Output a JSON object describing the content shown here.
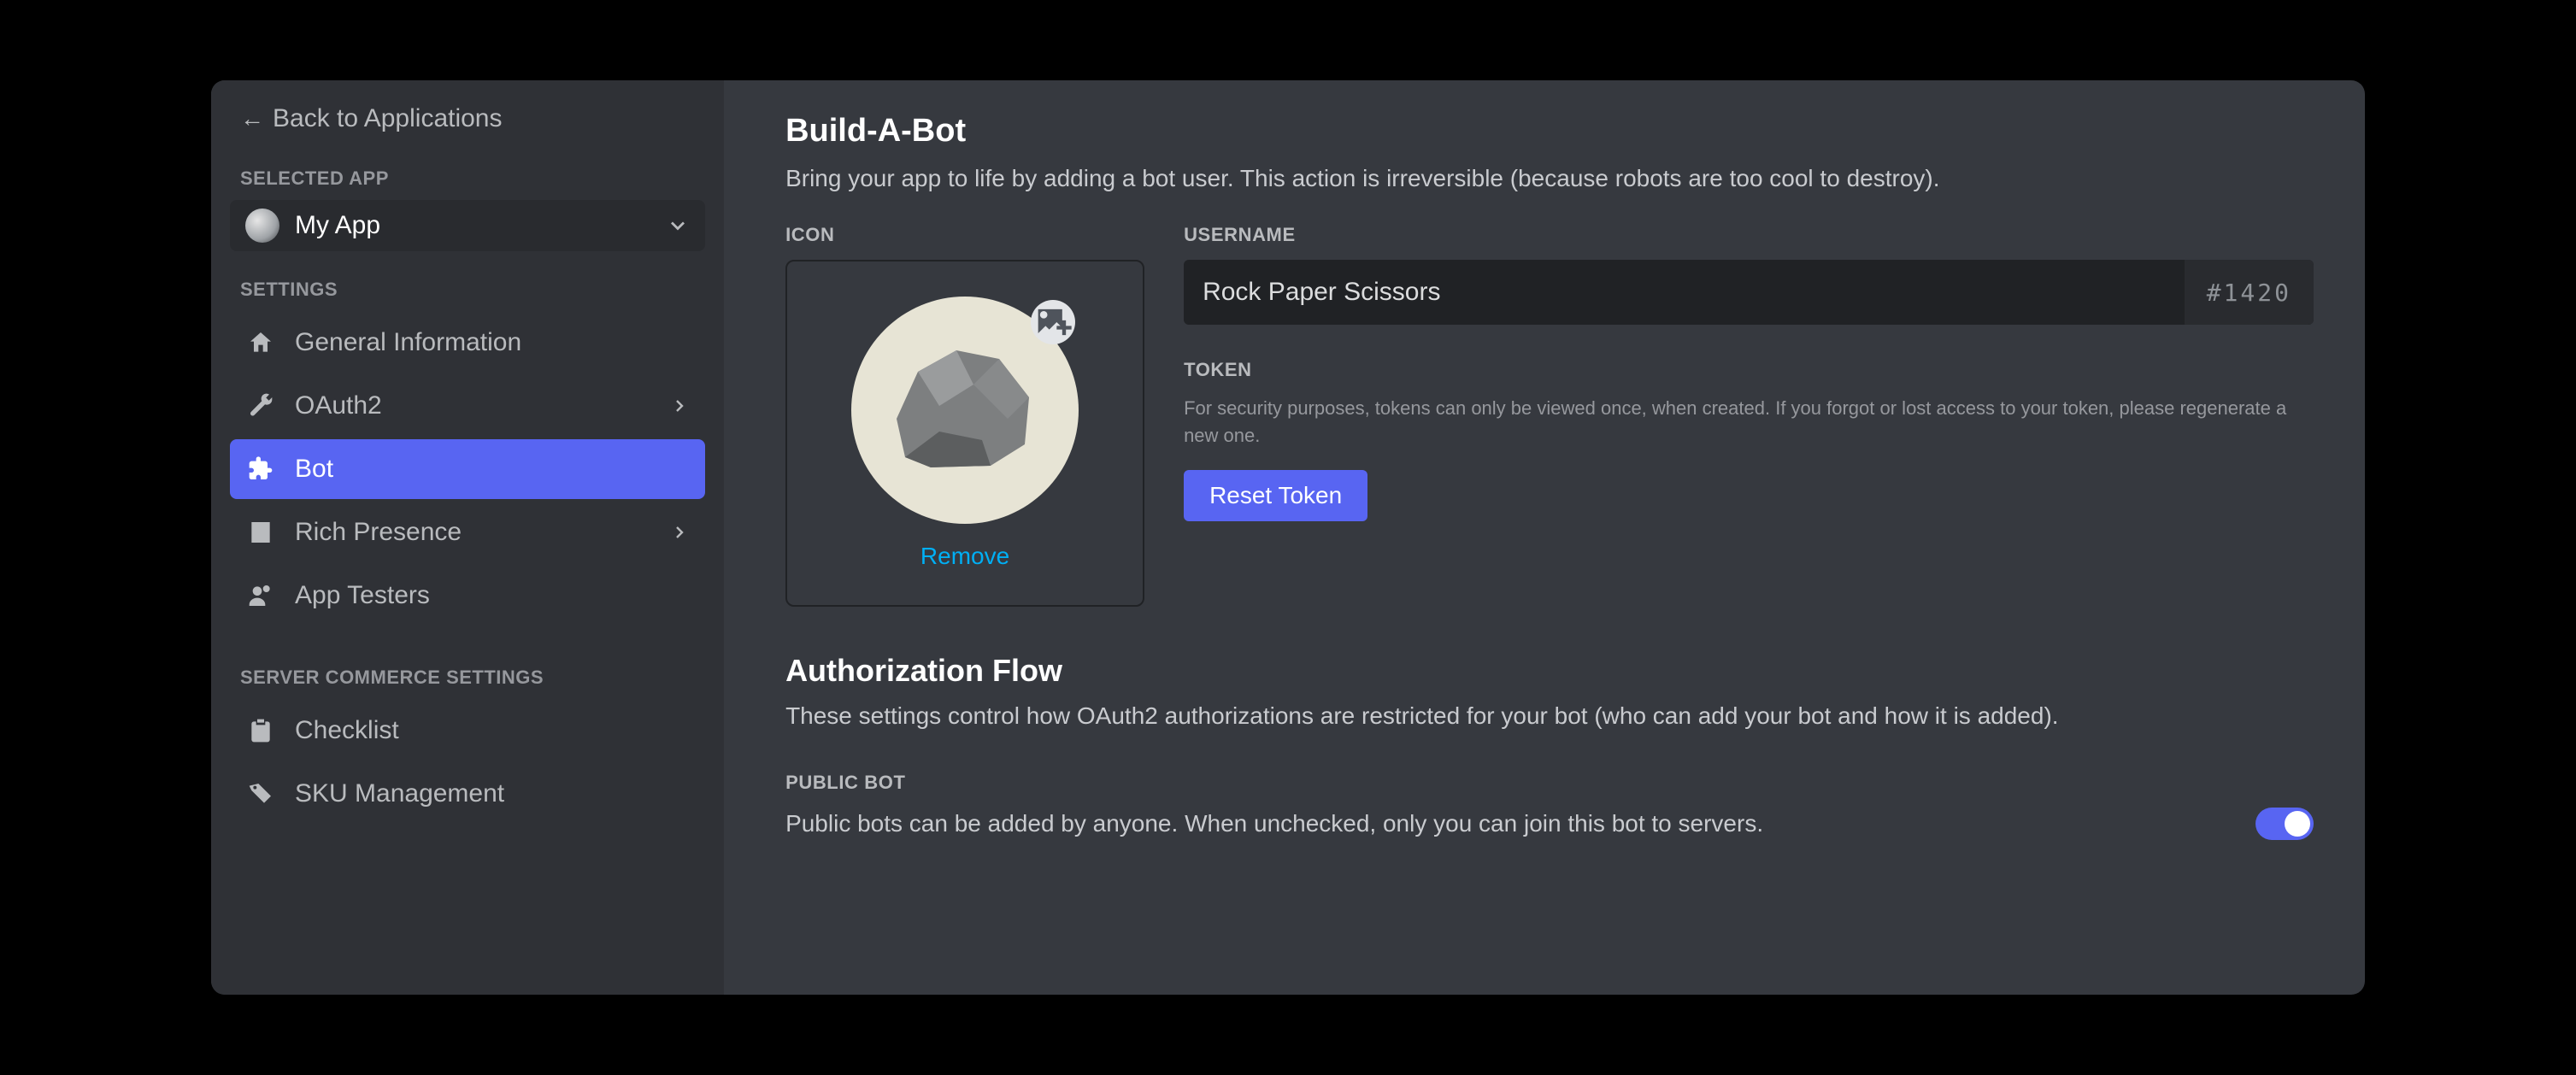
{
  "sidebar": {
    "back_label": "Back to Applications",
    "selected_app_header": "Selected App",
    "selected_app_name": "My App",
    "settings_header": "Settings",
    "items": [
      {
        "label": "General Information"
      },
      {
        "label": "OAuth2"
      },
      {
        "label": "Bot"
      },
      {
        "label": "Rich Presence"
      },
      {
        "label": "App Testers"
      }
    ],
    "commerce_header": "Server Commerce Settings",
    "commerce_items": [
      {
        "label": "Checklist"
      },
      {
        "label": "SKU Management"
      }
    ]
  },
  "main": {
    "build_title": "Build-A-Bot",
    "build_subtitle": "Bring your app to life by adding a bot user. This action is irreversible (because robots are too cool to destroy).",
    "icon_label": "Icon",
    "remove_label": "Remove",
    "username_label": "Username",
    "username_value": "Rock Paper Scissors",
    "username_tag": "#1420",
    "token_label": "Token",
    "token_help": "For security purposes, tokens can only be viewed once, when created. If you forgot or lost access to your token, please regenerate a new one.",
    "reset_token_label": "Reset Token",
    "auth_title": "Authorization Flow",
    "auth_desc": "These settings control how OAuth2 authorizations are restricted for your bot (who can add your bot and how it is added).",
    "public_bot_label": "Public Bot",
    "public_bot_desc": "Public bots can be added by anyone. When unchecked, only you can join this bot to servers.",
    "public_bot_on": true
  }
}
